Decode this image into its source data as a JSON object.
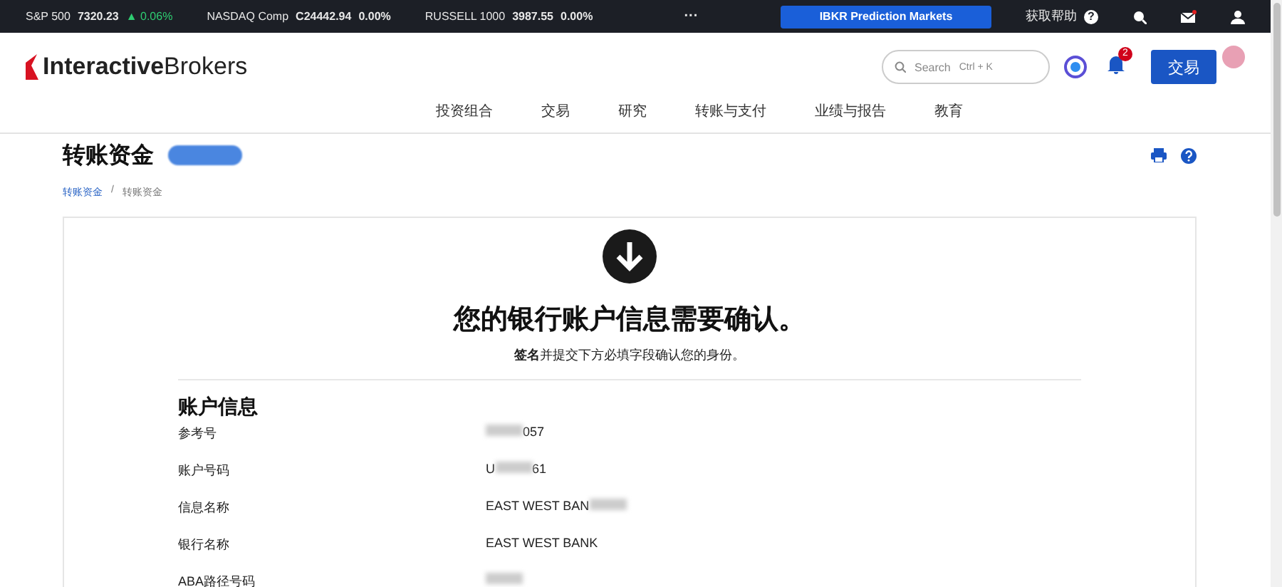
{
  "ticker": [
    {
      "name": "S&P 500",
      "value": "7320.23",
      "change": "▲ 0.06%",
      "kind": "up"
    },
    {
      "name": "NASDAQ Comp",
      "value": "C24442.94",
      "change": "0.00%",
      "kind": "flat"
    },
    {
      "name": "RUSSELL 1000",
      "value": "3987.55",
      "change": "0.00%",
      "kind": "flat"
    }
  ],
  "more": "···",
  "promo_button": "IBKR Prediction Markets",
  "help": {
    "label": "获取帮助",
    "icon": "?"
  },
  "logo": {
    "bold": "Interactive",
    "light": "Brokers"
  },
  "search": {
    "placeholder": "Search",
    "shortcut": "Ctrl + K"
  },
  "notifications": {
    "count": "2"
  },
  "trade_button": "交易",
  "nav": [
    "投资组合",
    "交易",
    "研究",
    "转账与支付",
    "业绩与报告",
    "教育"
  ],
  "page": {
    "title": "转账资金",
    "breadcrumb_separator": "/",
    "breadcrumbs": [
      {
        "label": "转账资金",
        "link": true
      },
      {
        "label": "转账资金",
        "link": false
      }
    ]
  },
  "notice": {
    "heading": "您的银行账户信息需要确认。",
    "text": "**签名**并提交下方必填字段确认您的身份。"
  },
  "section": {
    "title": "账户信息",
    "rows": [
      {
        "label": "参考号",
        "parts": [
          {
            "kind": "blur"
          },
          {
            "kind": "text",
            "text": "057"
          }
        ]
      },
      {
        "label": "账户号码",
        "parts": [
          {
            "kind": "text",
            "text": "U"
          },
          {
            "kind": "blur"
          },
          {
            "kind": "text",
            "text": "61"
          }
        ]
      },
      {
        "label": "信息名称",
        "parts": [
          {
            "kind": "text",
            "text": "EAST WEST BAN"
          },
          {
            "kind": "blur"
          }
        ]
      },
      {
        "label": "银行名称",
        "parts": [
          {
            "kind": "text",
            "text": "EAST WEST BANK"
          }
        ]
      },
      {
        "label": "ABA路径号码",
        "parts": [
          {
            "kind": "blur"
          }
        ]
      }
    ]
  }
}
